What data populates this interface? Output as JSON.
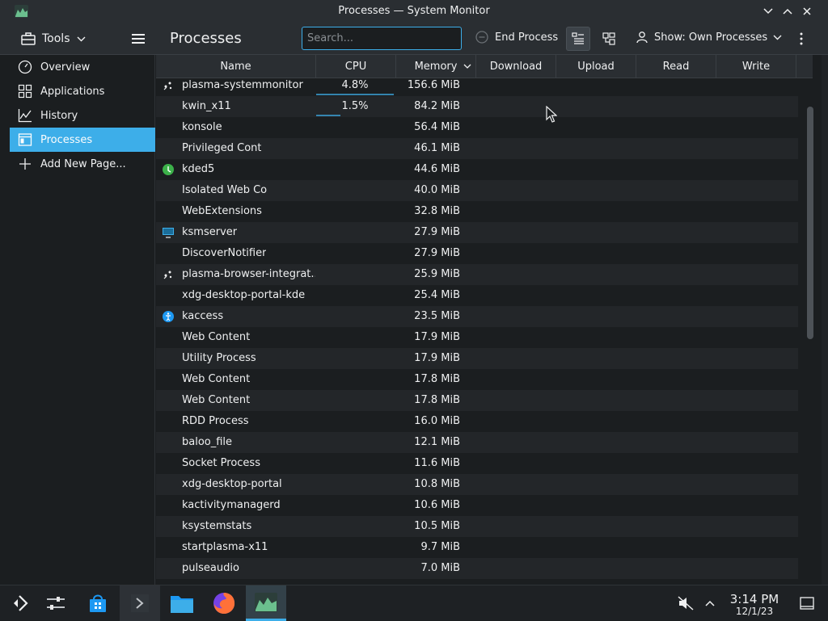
{
  "window": {
    "title": "Processes — System Monitor"
  },
  "toolbar": {
    "tools_label": "Tools",
    "page_title": "Processes",
    "search_placeholder": "Search...",
    "end_process_label": "End Process",
    "show_label": "Show: Own Processes"
  },
  "sidebar": {
    "items": [
      {
        "label": "Overview",
        "icon": "gauge-icon"
      },
      {
        "label": "Applications",
        "icon": "grid-icon"
      },
      {
        "label": "History",
        "icon": "chart-icon"
      },
      {
        "label": "Processes",
        "icon": "window-icon"
      },
      {
        "label": "Add New Page...",
        "icon": "plus-icon"
      }
    ]
  },
  "columns": [
    "Name",
    "CPU",
    "Memory",
    "Download",
    "Upload",
    "Read",
    "Write"
  ],
  "processes": [
    {
      "name": "plasma-systemmonitor",
      "cpu": "4.8%",
      "cpu_fraction": 0.048,
      "memory": "156.6 MiB",
      "icon": "plasma-icon"
    },
    {
      "name": "kwin_x11",
      "cpu": "1.5%",
      "cpu_fraction": 0.015,
      "memory": "84.2 MiB",
      "icon": ""
    },
    {
      "name": "konsole",
      "cpu": "",
      "memory": "56.4 MiB",
      "icon": ""
    },
    {
      "name": "Privileged Cont",
      "cpu": "",
      "memory": "46.1 MiB",
      "icon": ""
    },
    {
      "name": "kded5",
      "cpu": "",
      "memory": "44.6 MiB",
      "icon": "kded-icon"
    },
    {
      "name": "Isolated Web Co",
      "cpu": "",
      "memory": "40.0 MiB",
      "icon": ""
    },
    {
      "name": "WebExtensions",
      "cpu": "",
      "memory": "32.8 MiB",
      "icon": ""
    },
    {
      "name": "ksmserver",
      "cpu": "",
      "memory": "27.9 MiB",
      "icon": "monitor-icon"
    },
    {
      "name": "DiscoverNotifier",
      "cpu": "",
      "memory": "27.9 MiB",
      "icon": ""
    },
    {
      "name": "plasma-browser-integrat...",
      "cpu": "",
      "memory": "25.9 MiB",
      "icon": "plasma-icon"
    },
    {
      "name": "xdg-desktop-portal-kde",
      "cpu": "",
      "memory": "25.4 MiB",
      "icon": ""
    },
    {
      "name": "kaccess",
      "cpu": "",
      "memory": "23.5 MiB",
      "icon": "accessibility-icon"
    },
    {
      "name": "Web Content",
      "cpu": "",
      "memory": "17.9 MiB",
      "icon": ""
    },
    {
      "name": "Utility Process",
      "cpu": "",
      "memory": "17.9 MiB",
      "icon": ""
    },
    {
      "name": "Web Content",
      "cpu": "",
      "memory": "17.8 MiB",
      "icon": ""
    },
    {
      "name": "Web Content",
      "cpu": "",
      "memory": "17.8 MiB",
      "icon": ""
    },
    {
      "name": "RDD Process",
      "cpu": "",
      "memory": "16.0 MiB",
      "icon": ""
    },
    {
      "name": "baloo_file",
      "cpu": "",
      "memory": "12.1 MiB",
      "icon": ""
    },
    {
      "name": "Socket Process",
      "cpu": "",
      "memory": "11.6 MiB",
      "icon": ""
    },
    {
      "name": "xdg-desktop-portal",
      "cpu": "",
      "memory": "10.8 MiB",
      "icon": ""
    },
    {
      "name": "kactivitymanagerd",
      "cpu": "",
      "memory": "10.6 MiB",
      "icon": ""
    },
    {
      "name": "ksystemstats",
      "cpu": "",
      "memory": "10.5 MiB",
      "icon": ""
    },
    {
      "name": "startplasma-x11",
      "cpu": "",
      "memory": "9.7 MiB",
      "icon": ""
    },
    {
      "name": "pulseaudio",
      "cpu": "",
      "memory": "7.0 MiB",
      "icon": ""
    }
  ],
  "taskbar": {
    "time": "3:14 PM",
    "date": "12/1/23"
  },
  "colors": {
    "accent": "#3daee9",
    "background": "#1b1e20",
    "panel": "#2a2e32"
  }
}
